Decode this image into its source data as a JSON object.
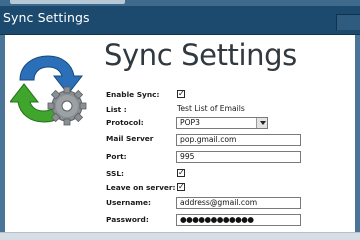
{
  "window": {
    "title": "Sync Settings"
  },
  "heading": "Sync Settings",
  "form": {
    "enable_sync": {
      "label": "Enable Sync:",
      "checked": true
    },
    "list": {
      "label": "List :",
      "value": "Test List of Emails"
    },
    "protocol": {
      "label": "Protocol:",
      "value": "POP3"
    },
    "mail_server": {
      "label": "Mail Server",
      "value": "pop.gmail.com"
    },
    "port": {
      "label": "Port:",
      "value": "995"
    },
    "ssl": {
      "label": "SSL:",
      "checked": true
    },
    "leave_on_server": {
      "label": "Leave on server:",
      "checked": true
    },
    "username": {
      "label": "Username:",
      "value": "address@gmail.com"
    },
    "password": {
      "label": "Password:",
      "value": "●●●●●●●●●●●●"
    }
  },
  "check_glyph": "✓",
  "icons": {
    "logo": "sync-gear-icon",
    "dropdown": "chevron-down-icon"
  },
  "colors": {
    "titlebar": "#1c4a6e",
    "arrow_blue": "#2a6fb8",
    "arrow_green": "#3fa52d",
    "gear": "#8a8f94"
  }
}
